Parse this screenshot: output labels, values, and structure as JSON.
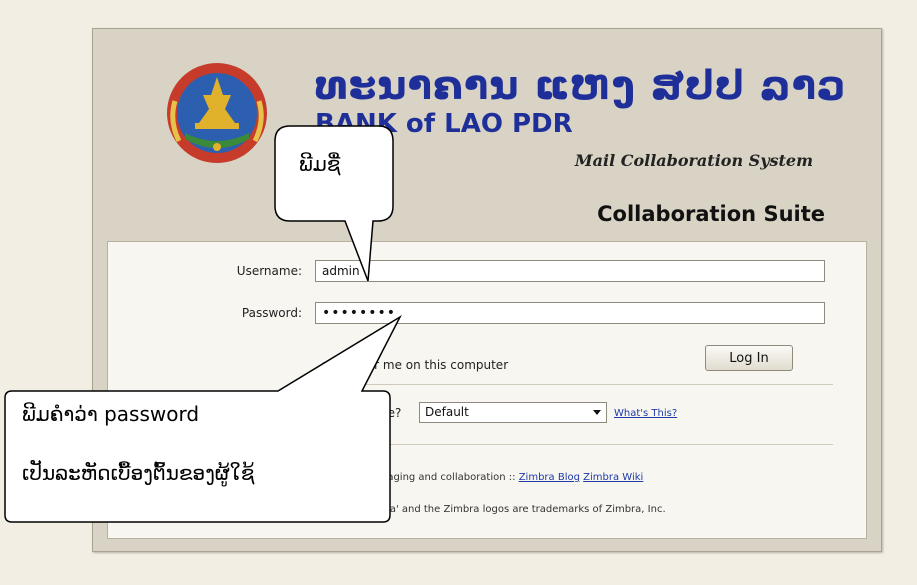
{
  "header": {
    "lao_name": "ທະນາຄານ ແຫງ ສປປ ລາວ",
    "bank_name": "BANK of LAO PDR",
    "subtitle": "Mail Collaboration System",
    "suite_title": "Collaboration Suite"
  },
  "form": {
    "username_label": "Username:",
    "username_value": "admin",
    "password_label": "Password:",
    "password_value": "••••••••",
    "remember_text": "emember me on this computer",
    "login_label": "Log In",
    "version_label": "te to use?",
    "version_selected": "Default",
    "whats_this": "What's This?"
  },
  "footer": {
    "line1_text": "messaging and collaboration ::",
    "blog_link": "Zimbra Blog",
    "wiki_link": "Zimbra Wiki",
    "line2_text": "Zimbra' and the Zimbra logos are trademarks of Zimbra, Inc."
  },
  "callouts": {
    "username_note": "ພີມຊື່",
    "password_note_line1": "ພີມຄໍາວ່າ password",
    "password_note_line2": "ເປັນລະຫັດເບື້ອງຕົ້ນຂອງຜູ້ໃຊ້"
  },
  "colors": {
    "title_blue": "#1f2f9a",
    "link_blue": "#1f3aa8",
    "panel": "#d8d3c4",
    "page_bg": "#f2eee3"
  }
}
